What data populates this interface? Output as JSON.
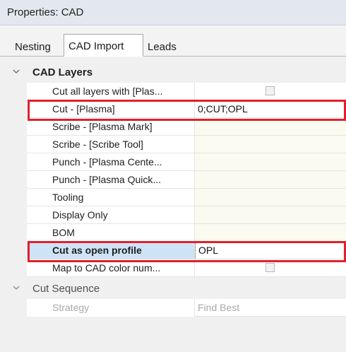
{
  "window": {
    "title": "Properties: CAD"
  },
  "tabs": [
    {
      "label": "Nesting",
      "active": false
    },
    {
      "label": "CAD Import",
      "active": true
    },
    {
      "label": "Leads",
      "active": false
    }
  ],
  "categories": [
    {
      "label": "CAD Layers",
      "expanded": true,
      "rows": [
        {
          "name": "Cut all layers with [Plas...",
          "type": "checkbox",
          "checked": false
        },
        {
          "name": "Cut - [Plasma]",
          "value": "0;CUT;OPL",
          "highlighted": true
        },
        {
          "name": "Scribe - [Plasma Mark]",
          "value": ""
        },
        {
          "name": "Scribe - [Scribe Tool]",
          "value": ""
        },
        {
          "name": "Punch - [Plasma Cente...",
          "value": ""
        },
        {
          "name": "Punch - [Plasma Quick...",
          "value": ""
        },
        {
          "name": "Tooling",
          "value": ""
        },
        {
          "name": "Display Only",
          "value": ""
        },
        {
          "name": "BOM",
          "value": ""
        },
        {
          "name": "Cut as open profile",
          "value": "OPL",
          "selected": true,
          "highlighted": true
        },
        {
          "name": "Map to CAD color num...",
          "type": "checkbox",
          "checked": false
        }
      ]
    },
    {
      "label": "Cut Sequence",
      "expanded": true,
      "rows": [
        {
          "name": "Strategy",
          "value": "Find Best"
        }
      ]
    }
  ],
  "colors": {
    "highlight_border": "#e0202c",
    "selected_row": "#cfe3f7",
    "value_cell": "#fbfaf0"
  }
}
